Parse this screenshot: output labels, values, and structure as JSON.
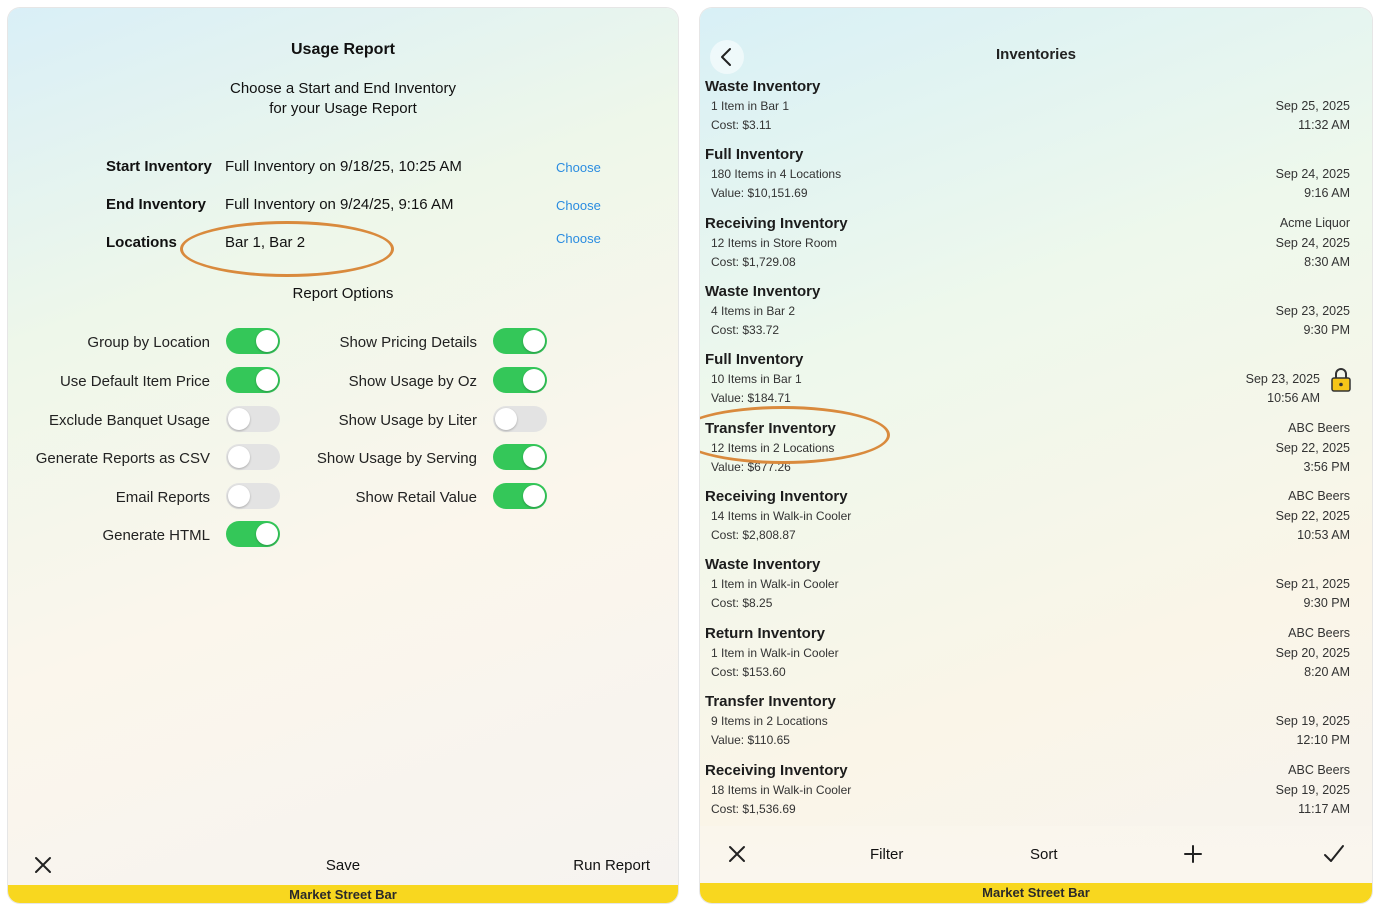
{
  "left": {
    "title": "Usage Report",
    "subtitle_line1": "Choose a Start and End Inventory",
    "subtitle_line2": "for your Usage Report",
    "rows": [
      {
        "label": "Start Inventory",
        "value": "Full Inventory on 9/18/25, 10:25 AM",
        "action": "Choose"
      },
      {
        "label": "End Inventory",
        "value": "Full Inventory on 9/24/25, 9:16 AM",
        "action": "Choose"
      },
      {
        "label": "Locations",
        "value": "Bar 1, Bar 2",
        "action": "Choose"
      }
    ],
    "report_options_heading": "Report Options",
    "options_left": [
      {
        "label": "Group by Location",
        "on": true
      },
      {
        "label": "Use Default Item Price",
        "on": true
      },
      {
        "label": "Exclude Banquet Usage",
        "on": false
      },
      {
        "label": "Generate Reports as CSV",
        "on": false
      },
      {
        "label": "Email Reports",
        "on": false
      },
      {
        "label": "Generate HTML",
        "on": true
      }
    ],
    "options_right": [
      {
        "label": "Show Pricing Details",
        "on": true
      },
      {
        "label": "Show Usage by Oz",
        "on": true
      },
      {
        "label": "Show Usage by Liter",
        "on": false
      },
      {
        "label": "Show Usage by Serving",
        "on": true
      },
      {
        "label": "Show Retail Value",
        "on": true
      }
    ],
    "toolbar": {
      "close_icon": "close-icon",
      "save": "Save",
      "run": "Run Report"
    },
    "footer": "Market Street Bar"
  },
  "right": {
    "title": "Inventories",
    "back_icon": "chevron-left-icon",
    "items": [
      {
        "name": "Waste Inventory",
        "line1": "1 Item in Bar 1",
        "line2": "Cost: $3.11",
        "vendor": "",
        "date": "Sep 25, 2025",
        "time": "11:32 AM",
        "locked": false
      },
      {
        "name": "Full Inventory",
        "line1": "180 Items in 4 Locations",
        "line2": "Value: $10,151.69",
        "vendor": "",
        "date": "Sep 24, 2025",
        "time": "9:16 AM",
        "locked": false
      },
      {
        "name": "Receiving Inventory",
        "line1": "12 Items in Store Room",
        "line2": "Cost: $1,729.08",
        "vendor": "Acme Liquor",
        "date": "Sep 24, 2025",
        "time": "8:30 AM",
        "locked": false
      },
      {
        "name": "Waste Inventory",
        "line1": "4 Items in Bar 2",
        "line2": "Cost: $33.72",
        "vendor": "",
        "date": "Sep 23, 2025",
        "time": "9:30 PM",
        "locked": false
      },
      {
        "name": "Full Inventory",
        "line1": "10 Items in Bar 1",
        "line2": "Value: $184.71",
        "vendor": "",
        "date": "Sep 23, 2025",
        "time": "10:56 AM",
        "locked": true
      },
      {
        "name": "Transfer Inventory",
        "line1": "12 Items in 2 Locations",
        "line2": "Value: $677.26",
        "vendor": "ABC Beers",
        "date": "Sep 22, 2025",
        "time": "3:56 PM",
        "locked": false
      },
      {
        "name": "Receiving Inventory",
        "line1": "14 Items in Walk-in Cooler",
        "line2": "Cost: $2,808.87",
        "vendor": "ABC Beers",
        "date": "Sep 22, 2025",
        "time": "10:53 AM",
        "locked": false
      },
      {
        "name": "Waste Inventory",
        "line1": "1 Item in Walk-in Cooler",
        "line2": "Cost: $8.25",
        "vendor": "",
        "date": "Sep 21, 2025",
        "time": "9:30 PM",
        "locked": false
      },
      {
        "name": "Return Inventory",
        "line1": "1 Item in Walk-in Cooler",
        "line2": "Cost: $153.60",
        "vendor": "ABC Beers",
        "date": "Sep 20, 2025",
        "time": "8:20 AM",
        "locked": false
      },
      {
        "name": "Transfer Inventory",
        "line1": "9 Items in 2 Locations",
        "line2": "Value: $110.65",
        "vendor": "",
        "date": "Sep 19, 2025",
        "time": "12:10 PM",
        "locked": false
      },
      {
        "name": "Receiving Inventory",
        "line1": "18 Items in Walk-in Cooler",
        "line2": "Cost: $1,536.69",
        "vendor": "ABC Beers",
        "date": "Sep 19, 2025",
        "time": "11:17 AM",
        "locked": false
      }
    ],
    "toolbar": {
      "close_icon": "close-icon",
      "filter": "Filter",
      "sort": "Sort",
      "add_icon": "plus-icon",
      "done_icon": "checkmark-icon"
    },
    "footer": "Market Street Bar"
  },
  "colors": {
    "accent": "#2a8ce0",
    "toggle_on": "#34c759",
    "footer_bar": "#f8d71f",
    "highlight": "#d98a3d"
  }
}
